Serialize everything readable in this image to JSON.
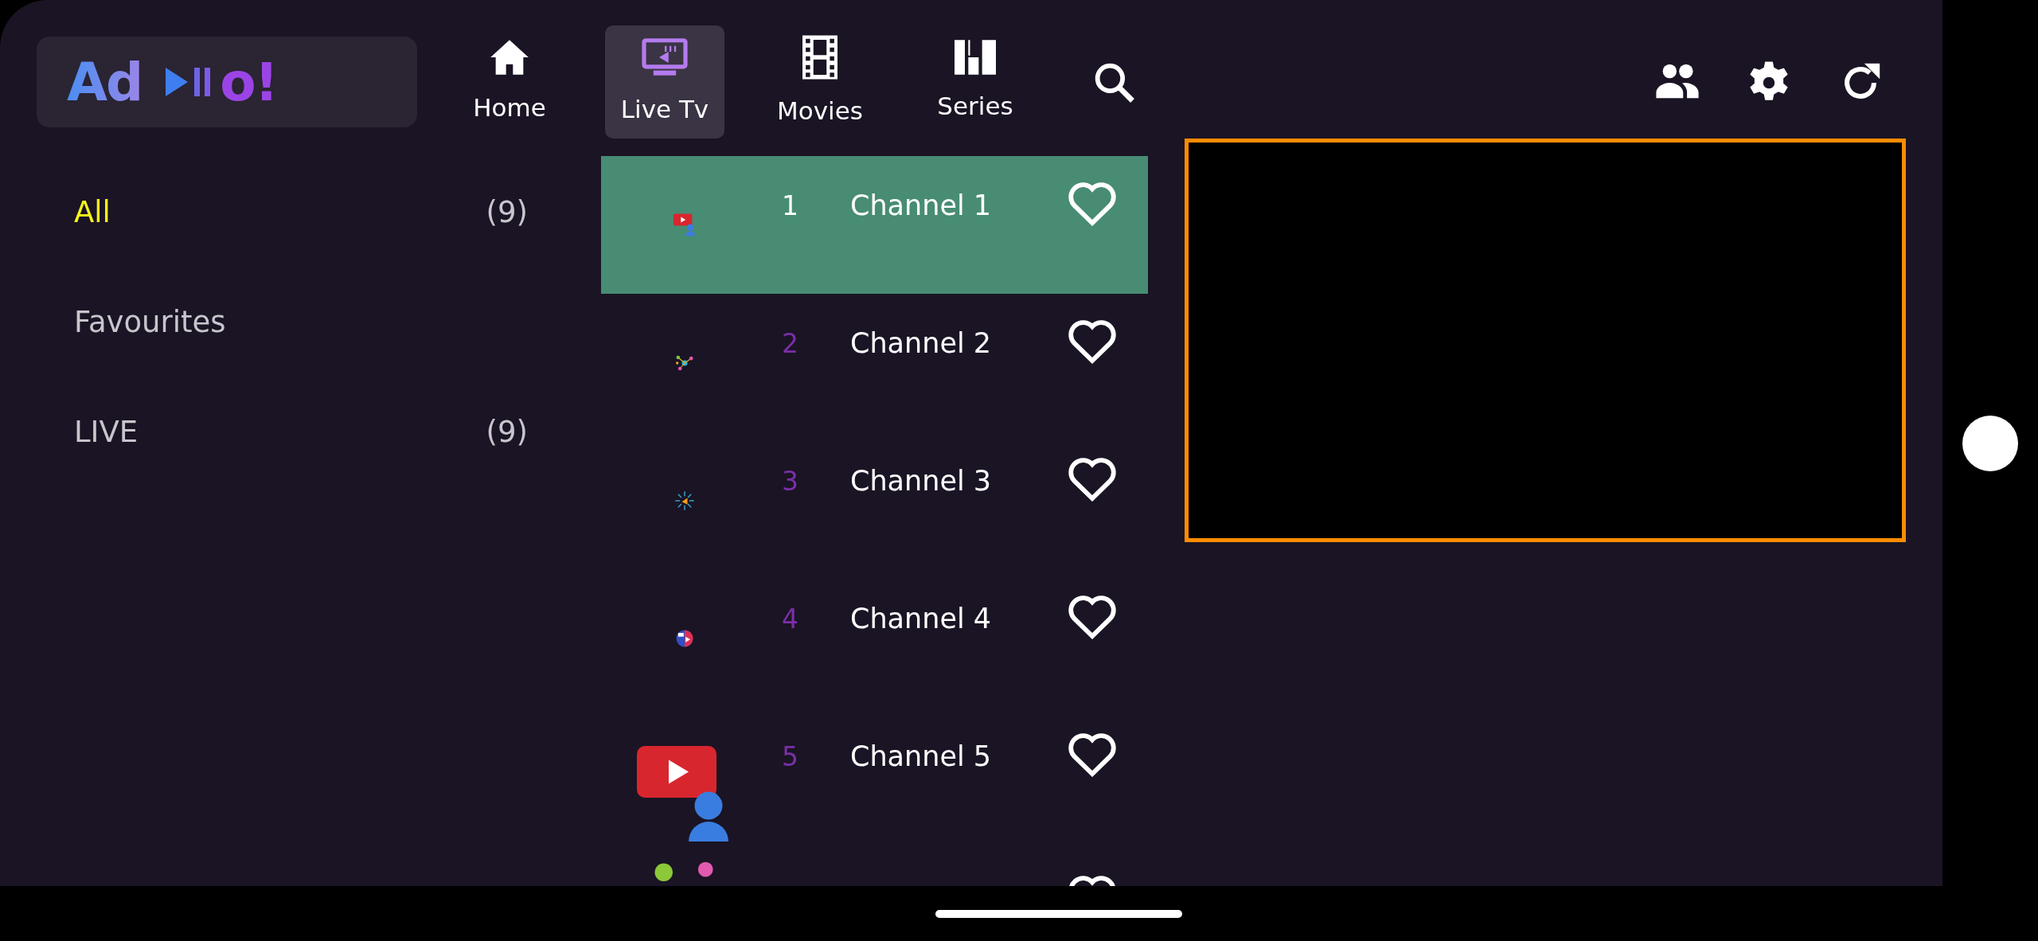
{
  "logo": {
    "start": "Ad",
    "end": "o!"
  },
  "nav": [
    {
      "label": "Home",
      "selected": false
    },
    {
      "label": "Live Tv",
      "selected": true
    },
    {
      "label": "Movies",
      "selected": false
    },
    {
      "label": "Series",
      "selected": false
    }
  ],
  "categories": [
    {
      "label": "All",
      "count": "(9)",
      "selected": true
    },
    {
      "label": "Favourites",
      "selected": false
    },
    {
      "label": "LIVE",
      "count": "(9)",
      "selected": false
    }
  ],
  "channels": [
    {
      "number": "1",
      "name": "Channel 1",
      "selected": true,
      "logo": {
        "kind": "video-user"
      }
    },
    {
      "number": "2",
      "name": "Channel 2",
      "selected": false,
      "logo": {
        "kind": "network"
      }
    },
    {
      "number": "3",
      "name": "Channel 3",
      "selected": false,
      "logo": {
        "kind": "burst"
      }
    },
    {
      "number": "4",
      "name": "Channel 4",
      "selected": false,
      "logo": {
        "kind": "globe"
      }
    },
    {
      "number": "5",
      "name": "Channel 5",
      "selected": false,
      "logo": {
        "kind": "video-user-large"
      }
    },
    {
      "selected": false,
      "cut_off": true,
      "logo": {
        "kind": "dots"
      }
    }
  ]
}
